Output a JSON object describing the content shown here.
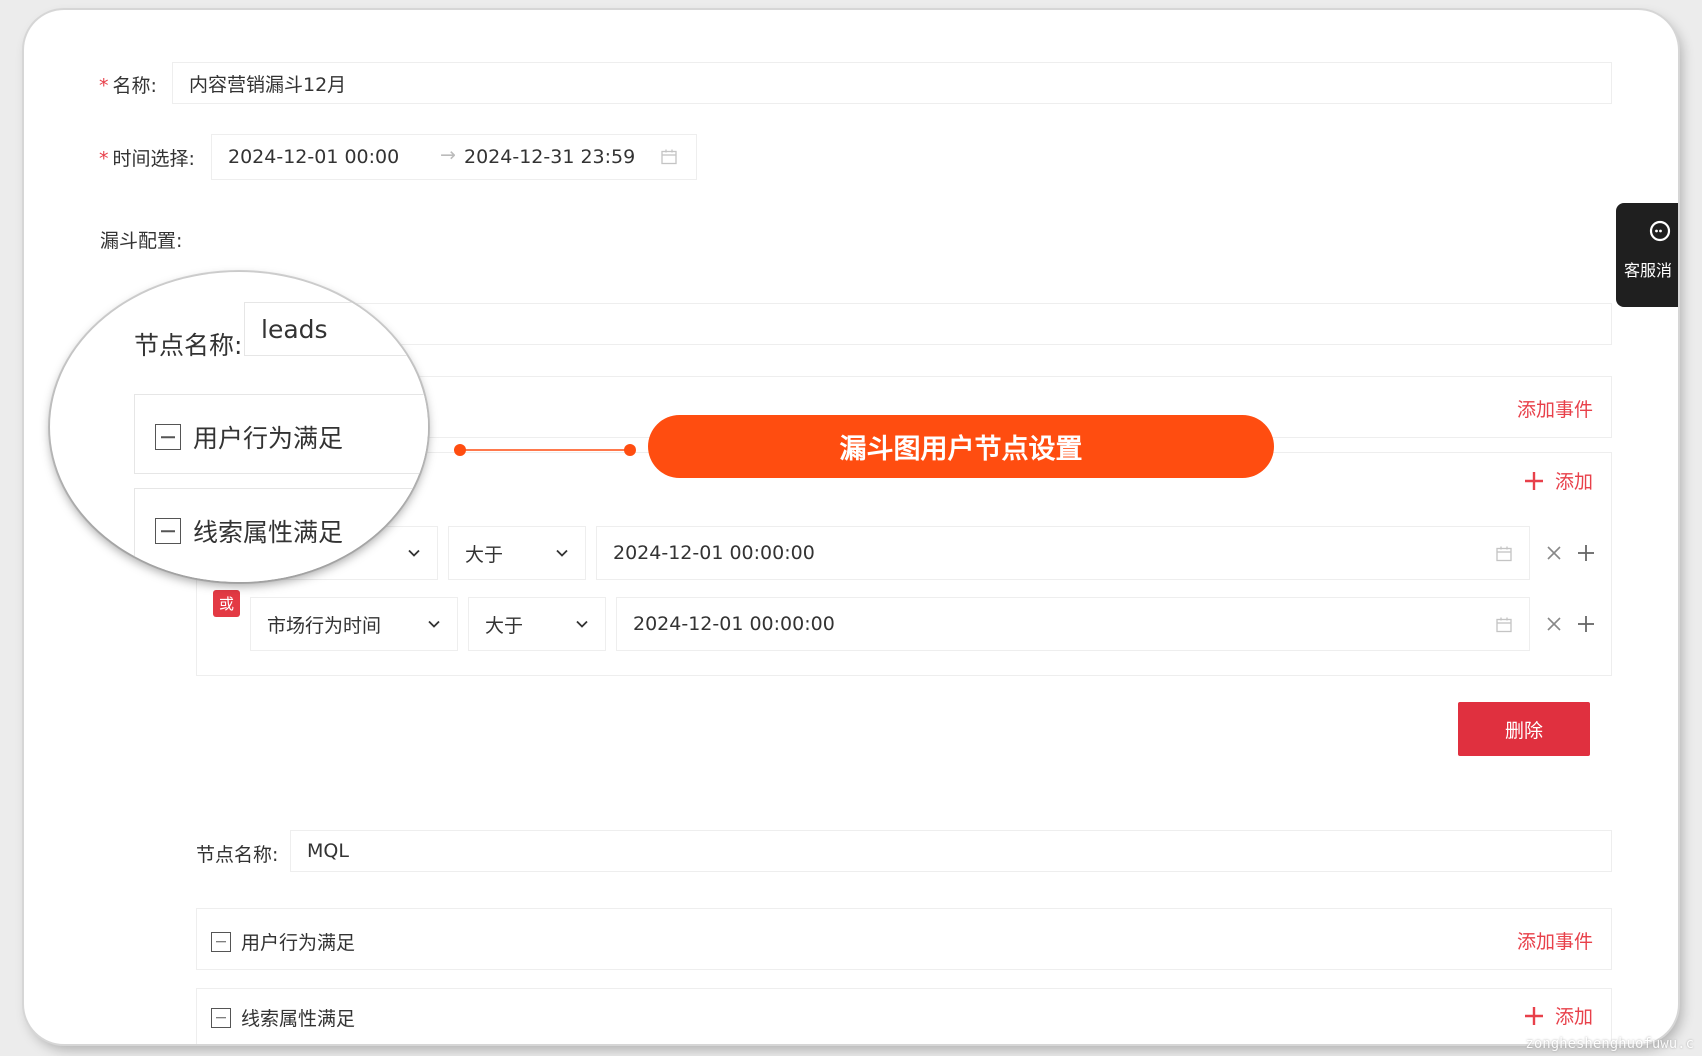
{
  "form": {
    "name_label": "名称:",
    "name_value": "内容营销漏斗12月",
    "time_label": "时间选择:",
    "time_start": "2024-12-01 00:00",
    "time_arrow": "→",
    "time_end": "2024-12-31 23:59",
    "funnel_config_label": "漏斗配置:"
  },
  "node1": {
    "name_label": "节点名称:",
    "name_value": "leads",
    "behavior_label": "用户行为满足",
    "add_event": "添加事件",
    "attr_label": "线索属性满足",
    "add_label": "添加",
    "rows": [
      {
        "field": "",
        "operator": "大于",
        "value": "2024-12-01 00:00:00"
      },
      {
        "field": "市场行为时间",
        "operator": "大于",
        "value": "2024-12-01 00:00:00"
      }
    ],
    "or_badge": "或",
    "delete_label": "删除"
  },
  "node2": {
    "name_label": "节点名称:",
    "name_value": "MQL",
    "behavior_label": "用户行为满足",
    "add_event": "添加事件",
    "attr_label": "线索属性满足",
    "add_label": "添加"
  },
  "callout": {
    "text": "漏斗图用户节点设置"
  },
  "support": {
    "label": "客服消"
  },
  "watermark": "zongheshenghuofuwu.c",
  "colors": {
    "accent_red": "#e8404a",
    "delete_bg": "#e0303f",
    "callout_orange": "#ff4d10",
    "support_bg": "#1f1f1f"
  }
}
